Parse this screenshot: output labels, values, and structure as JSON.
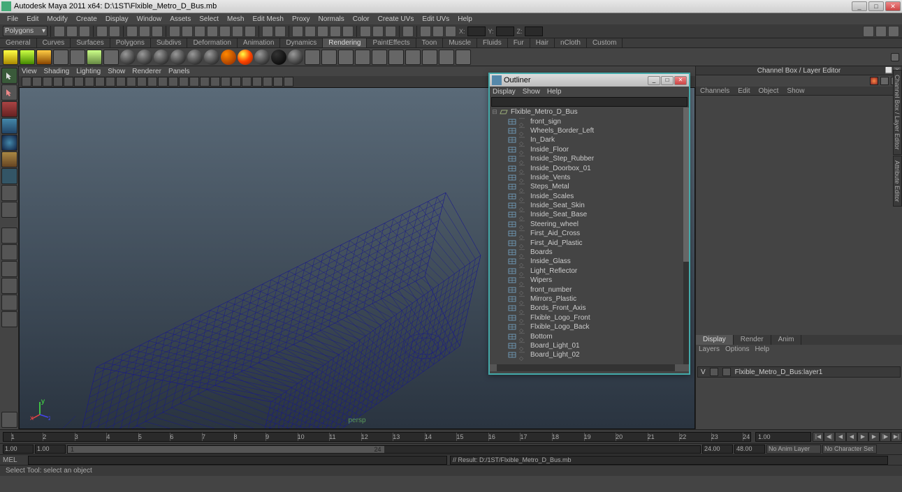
{
  "title": "Autodesk Maya 2011 x64: D:\\1ST\\Flxible_Metro_D_Bus.mb",
  "menu": [
    "File",
    "Edit",
    "Modify",
    "Create",
    "Display",
    "Window",
    "Assets",
    "Select",
    "Mesh",
    "Edit Mesh",
    "Proxy",
    "Normals",
    "Color",
    "Create UVs",
    "Edit UVs",
    "Help"
  ],
  "moduleCombo": "Polygons",
  "coords": {
    "x": "X:",
    "y": "Y:",
    "z": "Z:"
  },
  "shelfTabs": [
    "General",
    "Curves",
    "Surfaces",
    "Polygons",
    "Subdivs",
    "Deformation",
    "Animation",
    "Dynamics",
    "Rendering",
    "PaintEffects",
    "Toon",
    "Muscle",
    "Fluids",
    "Fur",
    "Hair",
    "nCloth",
    "Custom"
  ],
  "shelfActive": "Rendering",
  "viewMenu": [
    "View",
    "Shading",
    "Lighting",
    "Show",
    "Renderer",
    "Panels"
  ],
  "perspLabel": "persp",
  "rightPanel": {
    "title": "Channel Box / Layer Editor",
    "tabs": [
      "Channels",
      "Edit",
      "Object",
      "Show"
    ],
    "bottomTabs": [
      "Display",
      "Render",
      "Anim"
    ],
    "bottomActive": "Display",
    "subTabs": [
      "Layers",
      "Options",
      "Help"
    ],
    "layerV": "V",
    "layerName": "Flxible_Metro_D_Bus:layer1"
  },
  "vtabs": [
    "Channel Box / Layer Editor",
    "Attribute Editor"
  ],
  "timeline": {
    "ticks": [
      1,
      2,
      3,
      4,
      5,
      6,
      7,
      8,
      9,
      10,
      11,
      12,
      13,
      14,
      15,
      16,
      17,
      18,
      19,
      20,
      21,
      22,
      23,
      24
    ],
    "current": "1.00",
    "start": "1.00",
    "rangeStart": "1.00",
    "rangeMid": "24",
    "rangeEnd": "24.00",
    "rangeTotal": "48.00",
    "animLayer": "No Anim Layer",
    "charSet": "No Character Set"
  },
  "cmd": {
    "label": "MEL",
    "result": "// Result: D:/1ST/Flxible_Metro_D_Bus.mb"
  },
  "helpline": "Select Tool: select an object",
  "outliner": {
    "title": "Outliner",
    "menu": [
      "Display",
      "Show",
      "Help"
    ],
    "root": "Flxible_Metro_D_Bus",
    "items": [
      "front_sign",
      "Wheels_Border_Left",
      "In_Dark",
      "Inside_Floor",
      "Inside_Step_Rubber",
      "Inside_Doorbox_01",
      "Inside_Vents",
      "Steps_Metal",
      "Inside_Scales",
      "Inside_Seat_Skin",
      "Inside_Seat_Base",
      "Steering_wheel",
      "First_Aid_Cross",
      "First_Aid_Plastic",
      "Boards",
      "Inside_Glass",
      "Light_Reflector",
      "Wipers",
      "front_number",
      "Mirrors_Plastic",
      "Bords_Front_Axis",
      "Flxible_Logo_Front",
      "Flxible_Logo_Back",
      "Bottom",
      "Board_Light_01",
      "Board_Light_02"
    ]
  }
}
